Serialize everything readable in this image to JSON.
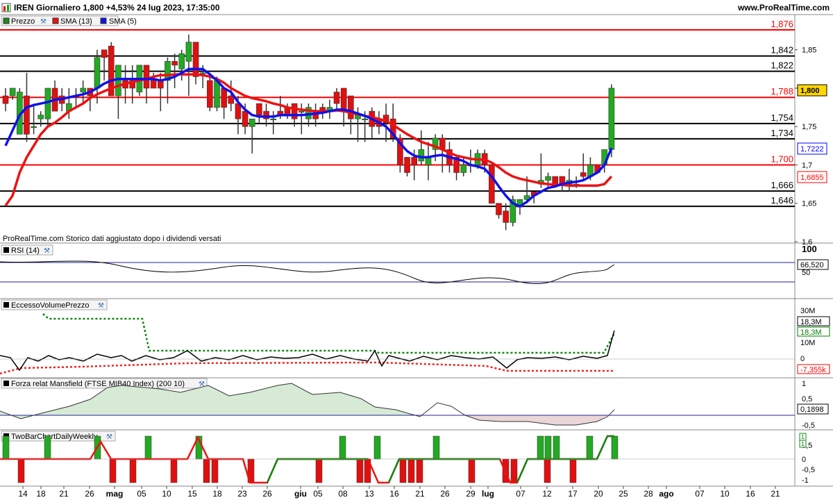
{
  "header": {
    "title": "IREN Giornaliero 1,800 +4,53% 24 lug 2023, 17:35:00",
    "site": "www.ProRealTime.com"
  },
  "price_panel": {
    "legend": {
      "price": "Prezzo",
      "sma13": "SMA (13)",
      "sma5": "SMA (5)"
    },
    "footer": "ProRealTime.com  Storico dati aggiustato dopo i dividendi versati",
    "hlines": [
      {
        "value": 1.876,
        "label": "1,876",
        "color": "#ff0000"
      },
      {
        "value": 1.842,
        "label": "1,842",
        "color": "#000000"
      },
      {
        "value": 1.822,
        "label": "1,822",
        "color": "#000000"
      },
      {
        "value": 1.788,
        "label": "1,788",
        "color": "#ff0000"
      },
      {
        "value": 1.754,
        "label": "1,754",
        "color": "#000000"
      },
      {
        "value": 1.734,
        "label": "1,734",
        "color": "#000000"
      },
      {
        "value": 1.7,
        "label": "1,700",
        "color": "#ff0000"
      },
      {
        "value": 1.666,
        "label": "1,666",
        "color": "#000000"
      },
      {
        "value": 1.646,
        "label": "1,646",
        "color": "#000000"
      }
    ],
    "axis_ticks": [
      "1,85",
      "1,8",
      "1,75",
      "1,7",
      "1,65",
      "1,6"
    ],
    "badges": [
      {
        "label": "1,800",
        "color": "#000000",
        "bg": "#ffd700"
      },
      {
        "label": "1,7222",
        "color": "#0000ff",
        "bg": "#ffffff"
      },
      {
        "label": "1,6855",
        "color": "#ff0000",
        "bg": "#ffffff"
      }
    ]
  },
  "rsi_panel": {
    "legend": "RSI (14)",
    "axis_ticks": [
      "100",
      "50"
    ],
    "badge": "66,520"
  },
  "volume_panel": {
    "legend": "EccessoVolumePrezzo",
    "axis_ticks": [
      "30M",
      "10M",
      "0"
    ],
    "badges": [
      {
        "label": "18,3M",
        "color": "#000000"
      },
      {
        "label": "18,3M",
        "color": "#008000"
      },
      {
        "label": "-7,355k",
        "color": "#ff0000"
      }
    ]
  },
  "mansfield_panel": {
    "legend": "Forza relat Mansfield (FTSE MIB40 Index) (200 10)",
    "axis_ticks": [
      "1",
      "0,5",
      "-0,5"
    ],
    "badge": "0,1898"
  },
  "twobar_panel": {
    "legend": "TwoBarChartDailyWeekly",
    "axis_ticks": [
      "0,5",
      "0",
      "-0,5",
      "-1"
    ],
    "badges": [
      "1",
      "1"
    ]
  },
  "x_axis": {
    "labels": [
      "14",
      "18",
      "21",
      "26",
      "mag",
      "05",
      "10",
      "15",
      "18",
      "23",
      "26",
      "giu",
      "05",
      "08",
      "13",
      "16",
      "21",
      "26",
      "29",
      "lug",
      "07",
      "12",
      "17",
      "20",
      "25",
      "28",
      "ago",
      "07",
      "10",
      "16",
      "21"
    ]
  },
  "chart_data": {
    "type": "candlestick",
    "title": "IREN Giornaliero",
    "ylim": [
      1.6,
      1.895
    ],
    "candles": [
      [
        1.79,
        1.8,
        1.77,
        1.78
      ],
      [
        1.79,
        1.8,
        1.785,
        1.8
      ],
      [
        1.74,
        1.8,
        1.74,
        1.795
      ],
      [
        1.79,
        1.82,
        1.73,
        1.74
      ],
      [
        1.75,
        1.78,
        1.74,
        1.75
      ],
      [
        1.76,
        1.77,
        1.75,
        1.765
      ],
      [
        1.76,
        1.8,
        1.75,
        1.8
      ],
      [
        1.8,
        1.81,
        1.77,
        1.77
      ],
      [
        1.79,
        1.8,
        1.77,
        1.78
      ],
      [
        1.77,
        1.8,
        1.76,
        1.78
      ],
      [
        1.79,
        1.8,
        1.775,
        1.79
      ],
      [
        1.795,
        1.81,
        1.78,
        1.8
      ],
      [
        1.8,
        1.8,
        1.77,
        1.79
      ],
      [
        1.8,
        1.85,
        1.78,
        1.84
      ],
      [
        1.85,
        1.85,
        1.81,
        1.84
      ],
      [
        1.855,
        1.86,
        1.79,
        1.79
      ],
      [
        1.79,
        1.83,
        1.76,
        1.83
      ],
      [
        1.81,
        1.83,
        1.78,
        1.8
      ],
      [
        1.81,
        1.83,
        1.78,
        1.8
      ],
      [
        1.795,
        1.83,
        1.79,
        1.83
      ],
      [
        1.83,
        1.83,
        1.78,
        1.8
      ],
      [
        1.81,
        1.82,
        1.8,
        1.8
      ],
      [
        1.81,
        1.82,
        1.77,
        1.8
      ],
      [
        1.81,
        1.84,
        1.78,
        1.835
      ],
      [
        1.835,
        1.845,
        1.8,
        1.83
      ],
      [
        1.825,
        1.85,
        1.81,
        1.845
      ],
      [
        1.835,
        1.87,
        1.79,
        1.86
      ],
      [
        1.86,
        1.86,
        1.805,
        1.815
      ],
      [
        1.82,
        1.83,
        1.8,
        1.82
      ],
      [
        1.81,
        1.82,
        1.77,
        1.775
      ],
      [
        1.775,
        1.815,
        1.77,
        1.81
      ],
      [
        1.8,
        1.8,
        1.76,
        1.775
      ],
      [
        1.79,
        1.81,
        1.77,
        1.78
      ],
      [
        1.78,
        1.79,
        1.74,
        1.76
      ],
      [
        1.77,
        1.78,
        1.74,
        1.75
      ],
      [
        1.75,
        1.76,
        1.715,
        1.76
      ],
      [
        1.78,
        1.78,
        1.755,
        1.765
      ],
      [
        1.77,
        1.78,
        1.75,
        1.76
      ],
      [
        1.76,
        1.77,
        1.74,
        1.76
      ],
      [
        1.77,
        1.79,
        1.76,
        1.765
      ],
      [
        1.775,
        1.78,
        1.76,
        1.765
      ],
      [
        1.78,
        1.78,
        1.75,
        1.76
      ],
      [
        1.77,
        1.78,
        1.74,
        1.77
      ],
      [
        1.76,
        1.78,
        1.75,
        1.775
      ],
      [
        1.77,
        1.78,
        1.75,
        1.76
      ],
      [
        1.775,
        1.78,
        1.76,
        1.77
      ],
      [
        1.77,
        1.785,
        1.76,
        1.775
      ],
      [
        1.795,
        1.8,
        1.77,
        1.78
      ],
      [
        1.8,
        1.8,
        1.75,
        1.77
      ],
      [
        1.79,
        1.79,
        1.74,
        1.76
      ],
      [
        1.76,
        1.775,
        1.73,
        1.765
      ],
      [
        1.76,
        1.77,
        1.73,
        1.76
      ],
      [
        1.77,
        1.775,
        1.735,
        1.75
      ],
      [
        1.76,
        1.77,
        1.74,
        1.75
      ],
      [
        1.765,
        1.78,
        1.73,
        1.755
      ],
      [
        1.76,
        1.78,
        1.73,
        1.735
      ],
      [
        1.735,
        1.74,
        1.69,
        1.7
      ],
      [
        1.71,
        1.71,
        1.685,
        1.69
      ],
      [
        1.71,
        1.72,
        1.68,
        1.7
      ],
      [
        1.705,
        1.745,
        1.7,
        1.72
      ],
      [
        1.7,
        1.73,
        1.68,
        1.71
      ],
      [
        1.72,
        1.74,
        1.705,
        1.735
      ],
      [
        1.735,
        1.74,
        1.69,
        1.72
      ],
      [
        1.72,
        1.73,
        1.69,
        1.7
      ],
      [
        1.71,
        1.71,
        1.68,
        1.69
      ],
      [
        1.69,
        1.71,
        1.685,
        1.7
      ],
      [
        1.7,
        1.72,
        1.69,
        1.7
      ],
      [
        1.7,
        1.72,
        1.695,
        1.715
      ],
      [
        1.715,
        1.72,
        1.69,
        1.7
      ],
      [
        1.7,
        1.7,
        1.65,
        1.65
      ],
      [
        1.65,
        1.65,
        1.63,
        1.635
      ],
      [
        1.64,
        1.65,
        1.615,
        1.625
      ],
      [
        1.625,
        1.66,
        1.62,
        1.655
      ],
      [
        1.645,
        1.655,
        1.635,
        1.655
      ],
      [
        1.655,
        1.685,
        1.65,
        1.66
      ],
      [
        1.665,
        1.665,
        1.65,
        1.66
      ],
      [
        1.675,
        1.715,
        1.67,
        1.68
      ],
      [
        1.68,
        1.69,
        1.67,
        1.685
      ],
      [
        1.685,
        1.685,
        1.67,
        1.675
      ],
      [
        1.685,
        1.685,
        1.665,
        1.675
      ],
      [
        1.675,
        1.695,
        1.665,
        1.68
      ],
      [
        1.675,
        1.685,
        1.67,
        1.675
      ],
      [
        1.69,
        1.715,
        1.68,
        1.685
      ],
      [
        1.685,
        1.71,
        1.68,
        1.7
      ],
      [
        1.7,
        1.7,
        1.69,
        1.69
      ],
      [
        1.7,
        1.715,
        1.69,
        1.72
      ],
      [
        1.72,
        1.805,
        1.71,
        1.8
      ]
    ],
    "series": [
      {
        "name": "SMA (13)",
        "values": [
          1.647,
          1.66,
          1.69,
          1.71,
          1.725,
          1.74,
          1.75,
          1.755,
          1.762,
          1.77,
          1.775,
          1.78,
          1.787,
          1.792,
          1.796,
          1.8,
          1.803,
          1.806,
          1.808,
          1.81,
          1.812,
          1.815,
          1.817,
          1.817,
          1.818,
          1.818,
          1.818,
          1.818,
          1.817,
          1.815,
          1.812,
          1.807,
          1.8,
          1.795,
          1.79,
          1.787,
          1.785,
          1.783,
          1.78,
          1.778,
          1.775,
          1.773,
          1.772,
          1.771,
          1.77,
          1.77,
          1.77,
          1.771,
          1.77,
          1.768,
          1.766,
          1.764,
          1.762,
          1.76,
          1.757,
          1.752,
          1.746,
          1.74,
          1.735,
          1.73,
          1.727,
          1.724,
          1.72,
          1.716,
          1.712,
          1.71,
          1.708,
          1.707,
          1.707,
          1.703,
          1.697,
          1.69,
          1.685,
          1.682,
          1.68,
          1.678,
          1.676,
          1.675,
          1.674,
          1.674,
          1.673,
          1.673,
          1.673,
          1.673,
          1.673,
          1.675,
          1.685
        ]
      },
      {
        "name": "SMA (5)",
        "values": [
          1.725,
          1.745,
          1.765,
          1.775,
          1.778,
          1.78,
          1.782,
          1.785,
          1.786,
          1.788,
          1.79,
          1.792,
          1.795,
          1.8,
          1.806,
          1.81,
          1.812,
          1.812,
          1.812,
          1.812,
          1.812,
          1.812,
          1.81,
          1.812,
          1.815,
          1.82,
          1.825,
          1.825,
          1.825,
          1.818,
          1.81,
          1.8,
          1.795,
          1.782,
          1.772,
          1.765,
          1.763,
          1.763,
          1.763,
          1.765,
          1.765,
          1.765,
          1.765,
          1.766,
          1.767,
          1.768,
          1.77,
          1.772,
          1.772,
          1.77,
          1.767,
          1.764,
          1.76,
          1.755,
          1.75,
          1.74,
          1.728,
          1.718,
          1.712,
          1.71,
          1.71,
          1.712,
          1.713,
          1.71,
          1.708,
          1.705,
          1.7,
          1.698,
          1.695,
          1.685,
          1.672,
          1.66,
          1.65,
          1.646,
          1.652,
          1.66,
          1.665,
          1.67,
          1.672,
          1.675,
          1.677,
          1.678,
          1.68,
          1.685,
          1.69,
          1.7,
          1.722
        ]
      }
    ]
  }
}
